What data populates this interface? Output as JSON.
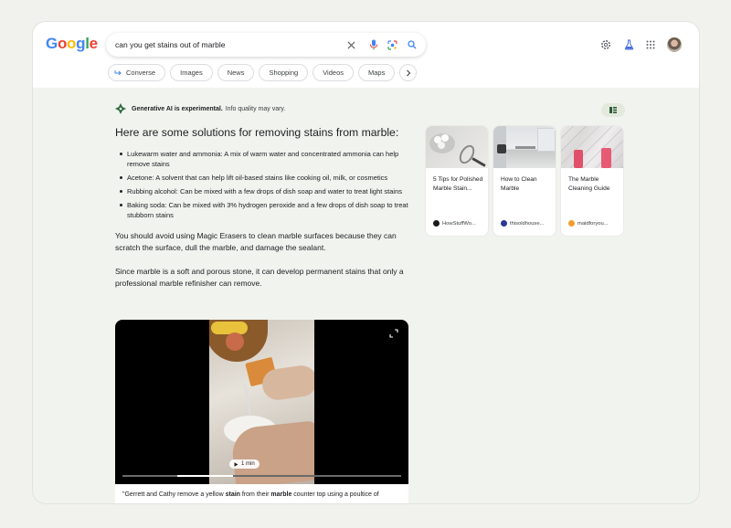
{
  "logo": {
    "letters": [
      {
        "ch": "G",
        "color": "#4285F4"
      },
      {
        "ch": "o",
        "color": "#EA4335"
      },
      {
        "ch": "o",
        "color": "#FBBC05"
      },
      {
        "ch": "g",
        "color": "#4285F4"
      },
      {
        "ch": "l",
        "color": "#34A853"
      },
      {
        "ch": "e",
        "color": "#EA4335"
      }
    ]
  },
  "search": {
    "query": "can you get stains out of marble"
  },
  "icons": {
    "clear": "close-icon",
    "mic": "mic-icon",
    "lens": "lens-icon",
    "search": "search-icon",
    "settings": "gear-icon",
    "labs": "flask-icon",
    "apps": "apps-grid-icon"
  },
  "chips": {
    "converse": "Converse",
    "images": "Images",
    "news": "News",
    "shopping": "Shopping",
    "videos": "Videos",
    "maps": "Maps"
  },
  "ai_notice": {
    "bold": "Generative AI is experimental.",
    "rest": "Info quality may vary."
  },
  "answer": {
    "heading": "Here are some solutions for removing stains from marble:",
    "bullets": [
      "Lukewarm water and ammonia: A mix of warm water and concentrated ammonia can help remove stains",
      "Acetone: A solvent that can help lift oil-based stains like cooking oil, milk, or cosmetics",
      "Rubbing alcohol: Can be mixed with a few drops of dish soap and water to treat light stains",
      "Baking soda: Can be mixed with 3% hydrogen peroxide and a few drops of dish soap to treat stubborn stains"
    ],
    "para1": "You should avoid using Magic Erasers to clean marble surfaces because they can scratch the surface, dull the marble, and damage the sealant.",
    "para2": "Since marble is a soft and porous stone, it can develop permanent stains that only a professional marble refinisher can remove."
  },
  "video": {
    "duration": "1 min",
    "progress": 0.2,
    "caption": {
      "p1": "\"Gerrett and Cathy remove a yellow ",
      "b1": "stain",
      "p2": " from their ",
      "b2": "marble",
      "p3": " counter top using a poultice of"
    }
  },
  "cards": [
    {
      "title": "5 Tips for Polished Marble Stain...",
      "source": "HowStuffWo...",
      "favicon_color": "#1a1a1a"
    },
    {
      "title": "How to Clean Marble",
      "source": "thisoldhouse...",
      "favicon_color": "#2b3a8f"
    },
    {
      "title": "The Marble Cleaning Guide",
      "source": "maidforyou...",
      "favicon_color": "#f0a030"
    }
  ]
}
